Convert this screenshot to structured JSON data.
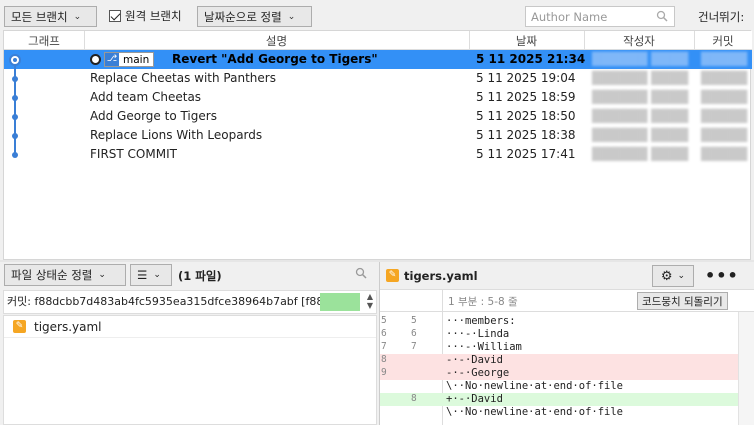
{
  "toolbar": {
    "branches_dropdown": "모든 브랜치",
    "remote_branches_label": "원격 브랜치",
    "sort_dropdown": "날짜순으로 정렬",
    "search_placeholder": "Author Name",
    "skip_label": "건너뛰기:"
  },
  "history": {
    "columns": [
      "그래프",
      "설명",
      "날짜",
      "작성자",
      "커밋"
    ],
    "branch_tag": "main",
    "rows": [
      {
        "message": "Revert \"Add George to Tigers\"",
        "date": "5 11 2025 21:34",
        "selected": true
      },
      {
        "message": "Replace Cheetas with Panthers",
        "date": "5 11 2025 19:04",
        "selected": false
      },
      {
        "message": "Add team Cheetas",
        "date": "5 11 2025 18:59",
        "selected": false
      },
      {
        "message": "Add George to Tigers",
        "date": "5 11 2025 18:50",
        "selected": false
      },
      {
        "message": "Replace Lions With Leopards",
        "date": "5 11 2025 18:38",
        "selected": false
      },
      {
        "message": "FIRST COMMIT",
        "date": "5 11 2025 17:41",
        "selected": false
      }
    ]
  },
  "file_panel": {
    "sort_dropdown": "파일 상태순 정렬",
    "view_dropdown": "☰",
    "file_count": "(1 파일)",
    "commit_info": "커밋: f88dcbb7d483ab4fc5935ea315dfce38964b7abf [f88dcbb]",
    "files": [
      {
        "name": "tigers.yaml"
      }
    ]
  },
  "diff": {
    "filename": "tigers.yaml",
    "hunk_header": "1 부분 : 5-8 줄",
    "revert_button": "코드뭉치 되돌리기",
    "lines": [
      {
        "old": "5",
        "new": "5",
        "type": "ctx",
        "text": "···members:"
      },
      {
        "old": "6",
        "new": "6",
        "type": "ctx",
        "text": "···-·Linda"
      },
      {
        "old": "7",
        "new": "7",
        "type": "ctx",
        "text": "···-·William"
      },
      {
        "old": "8",
        "new": "",
        "type": "del",
        "text": "-·-·David"
      },
      {
        "old": "9",
        "new": "",
        "type": "del",
        "text": "-·-·George"
      },
      {
        "old": "",
        "new": "",
        "type": "ctx",
        "text": "\\··No·newline·at·end·of·file"
      },
      {
        "old": "",
        "new": "8",
        "type": "add",
        "text": "+·-·David"
      },
      {
        "old": "",
        "new": "",
        "type": "ctx",
        "text": "\\··No·newline·at·end·of·file"
      }
    ]
  },
  "colors": {
    "selection": "#3390f6",
    "graph": "#3a7fd6",
    "deleted": "#fde2e2",
    "added": "#dcfadc"
  }
}
